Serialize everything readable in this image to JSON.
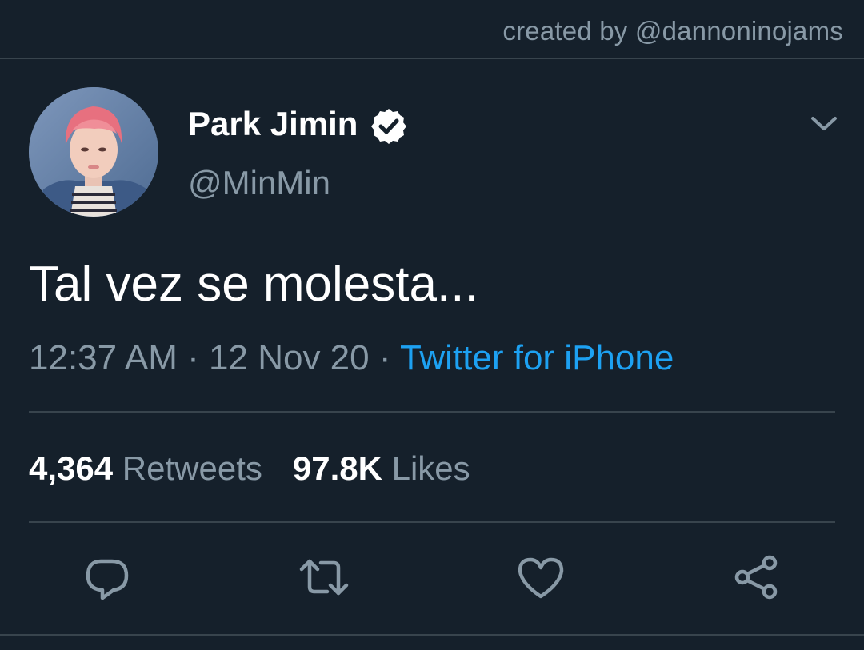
{
  "credit": "created by @dannoninojams",
  "user": {
    "display_name": "Park Jimin",
    "handle": "@MinMin",
    "verified": true
  },
  "tweet": {
    "text": "Tal vez se molesta...",
    "time": "12:37 AM",
    "separator": "·",
    "date": "12 Nov 20",
    "source": "Twitter for iPhone"
  },
  "stats": {
    "retweets_count": "4,364",
    "retweets_label": "Retweets",
    "likes_count": "97.8K",
    "likes_label": "Likes"
  },
  "icons": {
    "verified": "verified-badge-icon",
    "menu": "chevron-down-icon",
    "reply": "reply-icon",
    "retweet": "retweet-icon",
    "like": "heart-icon",
    "share": "share-icon"
  },
  "colors": {
    "background": "#15202b",
    "text_primary": "#ffffff",
    "text_secondary": "#8899a6",
    "accent": "#1da1f2",
    "divider": "#38444d"
  }
}
